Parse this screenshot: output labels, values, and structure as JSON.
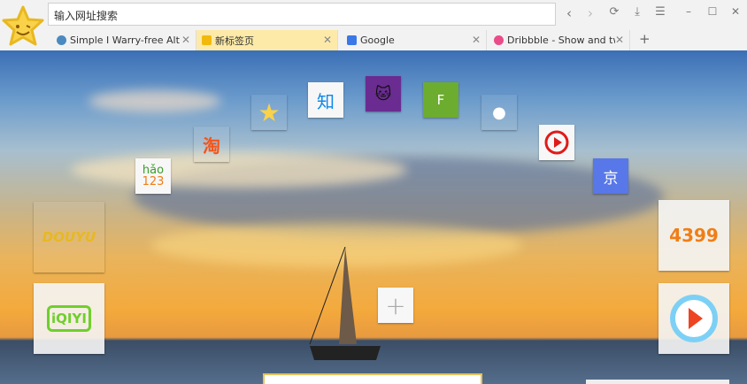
{
  "address_bar": {
    "placeholder": "输入网址搜索"
  },
  "toolbar": {
    "back": "‹",
    "forward": "›",
    "refresh": "⟳",
    "download": "⤓",
    "menu": "☰",
    "minimize": "–",
    "maximize": "☐",
    "close": "✕"
  },
  "tabs": [
    {
      "title": "Simple I Warry-free Alt",
      "color": "#4a8ac0"
    },
    {
      "title": "新标签页",
      "color": "#f2b90c",
      "active": true
    },
    {
      "title": "Google",
      "color": "#3b78e7"
    },
    {
      "title": "Dribbble - Show and tw",
      "color": "#ea4c89"
    }
  ],
  "new_tab": "+",
  "tab_close": "✕",
  "tiles": {
    "hao123": {
      "line1": "hǎo",
      "line2": "123"
    },
    "taobao": "淘",
    "zhihu": "知",
    "feedly": "F",
    "jd": "京",
    "douyu": "DOUYU",
    "iqiyi": "iQIYI",
    "game4399": "4399",
    "add": "+"
  },
  "colors": {
    "zhihu": "#0f88eb",
    "tmall": "#6a2c91",
    "feedly": "#6cac2f",
    "jd": "#5877e8",
    "g4399": "#f07e16",
    "iqiyi": "#6fcf2c"
  }
}
